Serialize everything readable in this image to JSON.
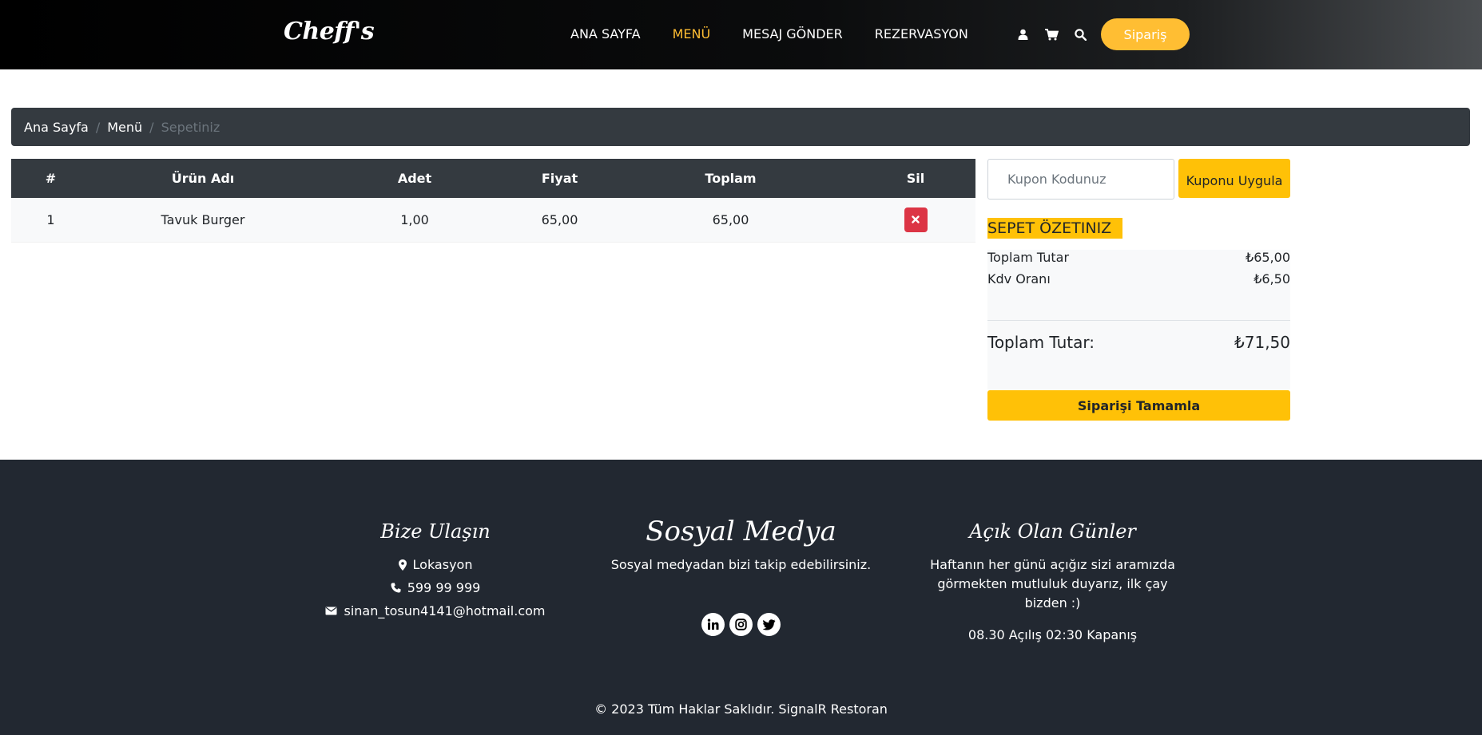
{
  "header": {
    "logo": "Cheff's",
    "nav": [
      {
        "label": "ANA SAYFA",
        "active": false
      },
      {
        "label": "MENÜ",
        "active": true
      },
      {
        "label": "MESAJ GÖNDER",
        "active": false
      },
      {
        "label": "REZERVASYON",
        "active": false
      }
    ],
    "icons": [
      "user-icon",
      "cart-icon",
      "search-icon"
    ],
    "order_button": "Sipariş"
  },
  "breadcrumb": {
    "items": [
      "Ana Sayfa",
      "Menü"
    ],
    "current": "Sepetiniz",
    "separator": "/"
  },
  "cart_table": {
    "headers": [
      "#",
      "Ürün Adı",
      "Adet",
      "Fiyat",
      "Toplam",
      "Sil"
    ],
    "rows": [
      {
        "no": "1",
        "product": "Tavuk Burger",
        "qty": "1,00",
        "price": "65,00",
        "total": "65,00"
      }
    ]
  },
  "coupon": {
    "placeholder": "Kupon Kodunuz",
    "button": "Kuponu Uygula"
  },
  "summary": {
    "title": "SEPET ÖZETINIZ",
    "rows": [
      {
        "label": "Toplam Tutar",
        "value": "₺65,00"
      },
      {
        "label": "Kdv Oranı",
        "value": "₺6,50"
      }
    ],
    "grand_label": "Toplam Tutar:",
    "grand_value": "₺71,50",
    "complete_button": "Siparişi Tamamla"
  },
  "footer": {
    "contact": {
      "title": "Bize Ulaşın",
      "location": "Lokasyon",
      "phone": "599 99 999",
      "email": "sinan_tosun4141@hotmail.com"
    },
    "social": {
      "title": "Sosyal Medya",
      "text": "Sosyal medyadan bizi takip edebilirsiniz.",
      "icons": [
        "linkedin-icon",
        "instagram-icon",
        "twitter-icon"
      ]
    },
    "hours": {
      "title": "Açık Olan Günler",
      "text": "Haftanın her günü açığız sizi aramızda görmekten mutluluk duyarız, ilk çay bizden :)",
      "times": "08.30 Açılış 02:30 Kapanış"
    },
    "copyright": "© 2023 Tüm Haklar Saklıdır. SignalR Restoran"
  },
  "colors": {
    "accent": "#ffbe33",
    "warning": "#ffc107",
    "dark": "#343a40",
    "footer": "#222831",
    "danger": "#dc3545"
  }
}
